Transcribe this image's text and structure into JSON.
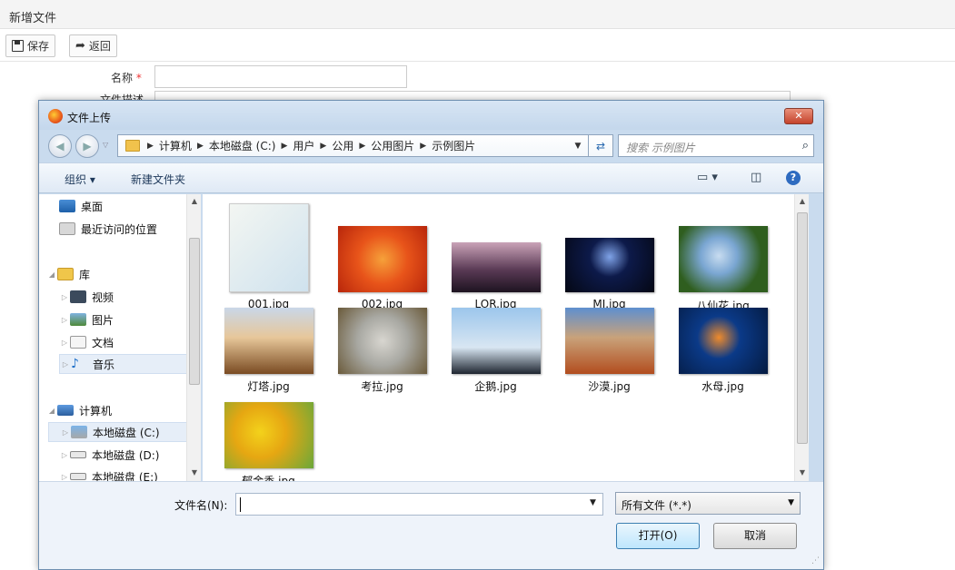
{
  "page": {
    "title": "新增文件"
  },
  "toolbar": {
    "save_label": "保存",
    "back_label": "返回"
  },
  "form": {
    "name_label": "名称",
    "required_mark": "*",
    "desc_label": "文件描述"
  },
  "dialog": {
    "title": "文件上传",
    "close_label": "✕",
    "breadcrumb": [
      "计算机",
      "本地磁盘 (C:)",
      "用户",
      "公用",
      "公用图片",
      "示例图片"
    ],
    "search_placeholder": "搜索 示例图片",
    "organize_label": "组织 ▾",
    "new_folder_label": "新建文件夹",
    "nav": {
      "favorites": [
        "桌面",
        "最近访问的位置"
      ],
      "library": {
        "label": "库",
        "items": [
          "视频",
          "图片",
          "文档",
          "音乐"
        ]
      },
      "computer": {
        "label": "计算机",
        "items": [
          "本地磁盘 (C:)",
          "本地磁盘 (D:)",
          "本地磁盘 (E:)"
        ]
      }
    },
    "files": [
      {
        "name": "001.jpg",
        "colors": [
          "#f3f6f2",
          "#cfe2ee"
        ]
      },
      {
        "name": "002.jpg",
        "colors": [
          "#e8541a",
          "#b8260b"
        ]
      },
      {
        "name": "LOR.jpg",
        "colors": [
          "#caa3b8",
          "#1d1320"
        ]
      },
      {
        "name": "MJ.jpg",
        "colors": [
          "#0d1a4a",
          "#040713"
        ]
      },
      {
        "name": "八仙花.jpg",
        "colors": [
          "#7aa6d2",
          "#2f5e1f"
        ]
      },
      {
        "name": "灯塔.jpg",
        "colors": [
          "#c9d7e8",
          "#7a4b22"
        ]
      },
      {
        "name": "考拉.jpg",
        "colors": [
          "#a8a8a2",
          "#6a5a3a"
        ]
      },
      {
        "name": "企鹅.jpg",
        "colors": [
          "#9cc6ec",
          "#d8e6f2"
        ]
      },
      {
        "name": "沙漠.jpg",
        "colors": [
          "#5e8fcf",
          "#b24d1e"
        ]
      },
      {
        "name": "水母.jpg",
        "colors": [
          "#0b3a88",
          "#ef8b2c"
        ]
      },
      {
        "name": "郁金香.jpg",
        "colors": [
          "#f3d21b",
          "#6aa83a"
        ]
      }
    ],
    "filename_label": "文件名(N):",
    "filename_value": "",
    "filetype_value": "所有文件 (*.*)",
    "open_label": "打开(O)",
    "cancel_label": "取消"
  }
}
